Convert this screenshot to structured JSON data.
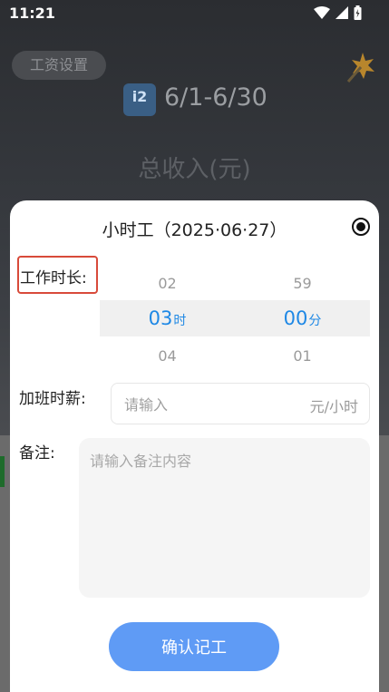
{
  "status_bar": {
    "time": "11:21",
    "icons": [
      "wifi-icon",
      "signal-icon",
      "battery-icon"
    ]
  },
  "background": {
    "wage_settings_label": "工资设置",
    "brand_icon_text": "i2",
    "period": "6/1-6/30",
    "income_title": "总收入(元)"
  },
  "sheet": {
    "title": "小时工（2025·06·27）",
    "work_duration_label": "工作时长:",
    "picker": {
      "hours": {
        "prev": "02",
        "current": "03",
        "unit": "时",
        "next": "04"
      },
      "minutes": {
        "prev": "59",
        "current": "00",
        "unit": "分",
        "next": "01"
      }
    },
    "overtime_rate_label": "加班时薪:",
    "overtime_rate_placeholder": "请输入",
    "overtime_rate_unit": "元/小时",
    "note_label": "备注:",
    "note_placeholder": "请输入备注内容",
    "confirm_label": "确认记工"
  },
  "colors": {
    "accent": "#1e88e5",
    "button": "#5f9bf5",
    "highlight_border": "#d84a3a"
  }
}
